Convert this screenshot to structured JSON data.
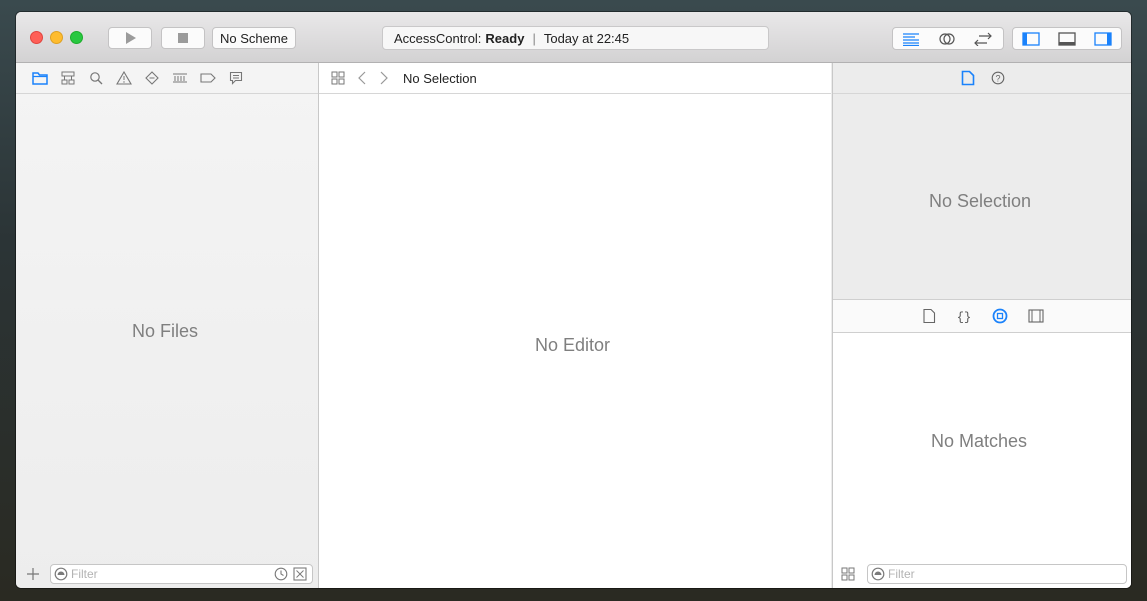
{
  "toolbar": {
    "scheme_label": "No Scheme",
    "activity": {
      "project": "AccessControl:",
      "status": "Ready",
      "time": "Today at 22:45"
    }
  },
  "navigator": {
    "tabs": [
      "project-navigator",
      "symbol-navigator",
      "find-navigator",
      "issue-navigator",
      "test-navigator",
      "debug-navigator",
      "breakpoint-navigator",
      "report-navigator"
    ],
    "empty_label": "No Files",
    "filter_placeholder": "Filter"
  },
  "editor": {
    "jump_bar_title": "No Selection",
    "empty_label": "No Editor"
  },
  "inspector": {
    "empty_label": "No Selection",
    "library_empty_label": "No Matches",
    "filter_placeholder": "Filter"
  },
  "colors": {
    "close": "#fe5f57",
    "minimize": "#febc2e",
    "zoom": "#28c840",
    "accent": "#1a82fb"
  }
}
